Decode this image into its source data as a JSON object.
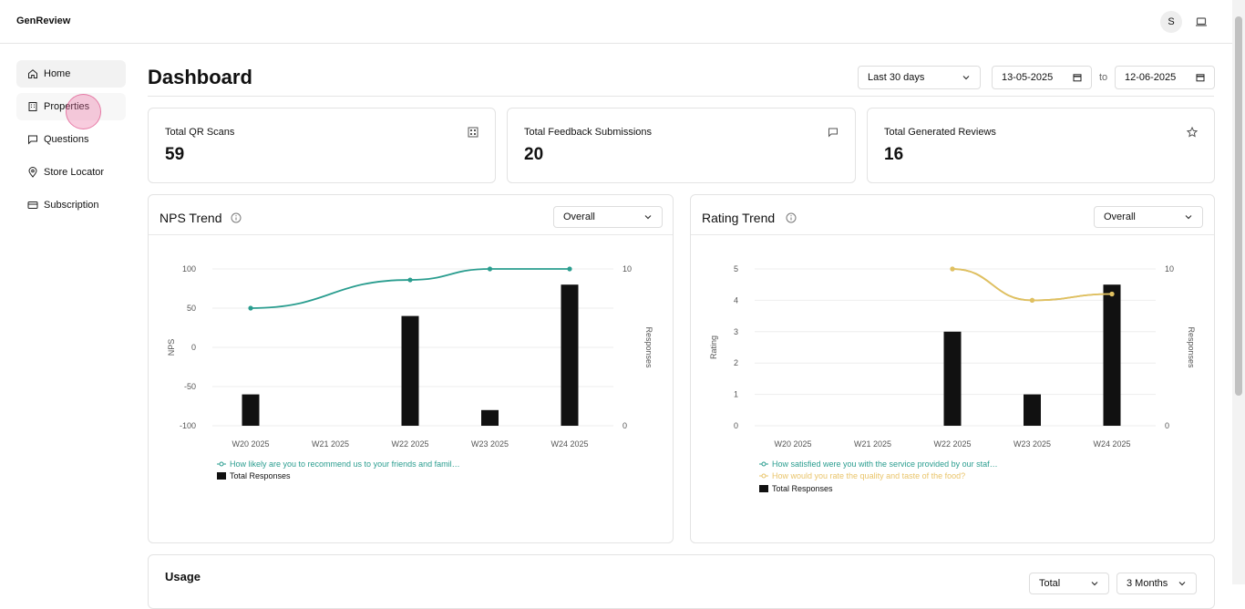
{
  "app": {
    "brand": "GenReview",
    "user_initial": "S"
  },
  "sidebar": {
    "items": [
      {
        "label": "Home",
        "icon": "home-icon"
      },
      {
        "label": "Properties",
        "icon": "building-icon"
      },
      {
        "label": "Questions",
        "icon": "message-square-icon"
      },
      {
        "label": "Store Locator",
        "icon": "map-pin-icon"
      },
      {
        "label": "Subscription",
        "icon": "credit-card-icon"
      }
    ]
  },
  "header": {
    "title": "Dashboard",
    "range": "Last 30 days",
    "date_from": "13-05-2025",
    "to_label": "to",
    "date_to": "12-06-2025"
  },
  "stats": [
    {
      "label": "Total QR Scans",
      "value": "59",
      "icon": "qr-code-icon"
    },
    {
      "label": "Total Feedback Submissions",
      "value": "20",
      "icon": "message-icon"
    },
    {
      "label": "Total Generated Reviews",
      "value": "16",
      "icon": "star-icon"
    }
  ],
  "nps": {
    "title": "NPS Trend",
    "filter": "Overall"
  },
  "rating": {
    "title": "Rating Trend",
    "filter": "Overall"
  },
  "usage": {
    "title": "Usage",
    "filter1": "Total",
    "filter2": "3 Months"
  },
  "colors": {
    "nps_line": "#2a9d8f",
    "rating_line1": "#2a9d8f",
    "rating_line2": "#e9c46a",
    "bars": "#111111"
  },
  "chart_data": [
    {
      "type": "bar",
      "title": "NPS Trend",
      "categories": [
        "W20 2025",
        "W21 2025",
        "W22 2025",
        "W23 2025",
        "W24 2025"
      ],
      "ylabel": "NPS",
      "y2label": "Responses",
      "ylim": [
        -100,
        100
      ],
      "yticks": [
        100,
        50,
        0,
        -50,
        -100
      ],
      "y2lim": [
        0,
        10
      ],
      "y2ticks": [
        10,
        0
      ],
      "series": [
        {
          "name": "How likely are you to recommend us to your friends and famil…",
          "type": "line",
          "axis": "left",
          "values": [
            50,
            null,
            86,
            100,
            100
          ]
        },
        {
          "name": "Total Responses",
          "type": "bar",
          "axis": "right",
          "values": [
            2,
            0,
            7,
            1,
            9
          ]
        }
      ]
    },
    {
      "type": "bar",
      "title": "Rating Trend",
      "categories": [
        "W20 2025",
        "W21 2025",
        "W22 2025",
        "W23 2025",
        "W24 2025"
      ],
      "ylabel": "Rating",
      "y2label": "Responses",
      "ylim": [
        0,
        5
      ],
      "yticks": [
        5,
        4,
        3,
        2,
        1,
        0
      ],
      "y2lim": [
        0,
        10
      ],
      "y2ticks": [
        10,
        0
      ],
      "series": [
        {
          "name": "How satisfied were you with the service provided by our staf…",
          "type": "line",
          "axis": "left",
          "values": [
            null,
            null,
            5,
            4,
            4.2
          ]
        },
        {
          "name": "How would you rate the quality and taste of the food?",
          "type": "line",
          "axis": "left",
          "values": [
            null,
            null,
            5,
            4,
            4.2
          ]
        },
        {
          "name": "Total Responses",
          "type": "bar",
          "axis": "left",
          "values": [
            0,
            0,
            3,
            1,
            4.5
          ]
        }
      ]
    }
  ]
}
